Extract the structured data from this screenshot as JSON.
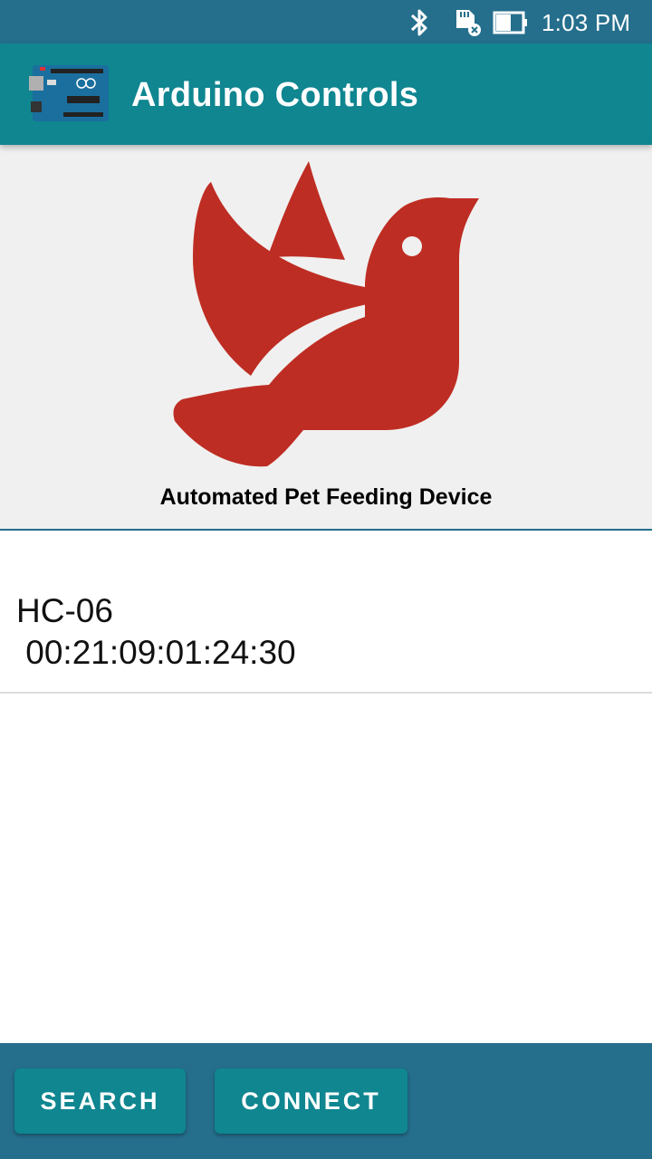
{
  "status_bar": {
    "time": "1:03 PM",
    "icons": [
      "bluetooth-icon",
      "sd-card-error-icon",
      "battery-icon"
    ]
  },
  "app_bar": {
    "title": "Arduino Controls",
    "logo": "arduino-board-icon",
    "color": "#0f8690"
  },
  "hero": {
    "image": "red-bird-icon",
    "image_color": "#be2d23",
    "caption": "Automated Pet Feeding Device"
  },
  "devices": [
    {
      "name": "HC-06",
      "address": " 00:21:09:01:24:30"
    }
  ],
  "actions": {
    "search_label": "SEARCH",
    "connect_label": "CONNECT"
  },
  "colors": {
    "status_bar": "#256f8d",
    "accent": "#0f8690",
    "bottom_bar": "#256f8d"
  }
}
